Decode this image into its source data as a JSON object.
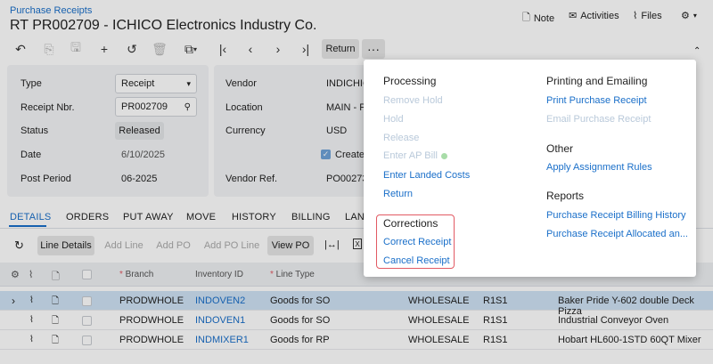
{
  "header": {
    "breadcrumb": "Purchase Receipts",
    "title": "RT PR002709 - ICHICO Electronics Industry Co.",
    "actions": {
      "note": "Note",
      "activities": "Activities",
      "files": "Files"
    }
  },
  "toolbar": {
    "return_label": "Return",
    "more_label": "···"
  },
  "form": {
    "type_label": "Type",
    "type_value": "Receipt",
    "receipt_nbr_label": "Receipt Nbr.",
    "receipt_nbr_value": "PR002709",
    "status_label": "Status",
    "status_value": "Released",
    "date_label": "Date",
    "date_value": "6/10/2025",
    "post_period_label": "Post Period",
    "post_period_value": "06-2025",
    "vendor_label": "Vendor",
    "vendor_value": "INDICHIC",
    "location_label": "Location",
    "location_value": "MAIN - P",
    "currency_label": "Currency",
    "currency_value": "USD",
    "create_label": "Create",
    "vendor_ref_label": "Vendor Ref.",
    "vendor_ref_value": "PO00273"
  },
  "tabs": [
    "DETAILS",
    "ORDERS",
    "PUT AWAY",
    "MOVE",
    "HISTORY",
    "BILLING",
    "LAN"
  ],
  "grid_toolbar": {
    "line_details": "Line Details",
    "add_line": "Add Line",
    "add_po": "Add PO",
    "add_po_line": "Add PO Line",
    "view_po": "View PO"
  },
  "grid": {
    "headers": {
      "branch": "Branch",
      "inventory_id": "Inventory ID",
      "line_type": "Line Type"
    },
    "rows": [
      {
        "branch": "PRODWHOLE",
        "inventory_id": "INDOVEN2",
        "line_type": "Goods for SO",
        "warehouse": "WHOLESALE",
        "location": "R1S1",
        "description": "Baker Pride Y-602 double Deck Pizza"
      },
      {
        "branch": "PRODWHOLE",
        "inventory_id": "INDOVEN1",
        "line_type": "Goods for SO",
        "warehouse": "WHOLESALE",
        "location": "R1S1",
        "description": "Industrial Conveyor Oven"
      },
      {
        "branch": "PRODWHOLE",
        "inventory_id": "INDMIXER1",
        "line_type": "Goods for RP",
        "warehouse": "WHOLESALE",
        "location": "R1S1",
        "description": "Hobart HL600-1STD 60QT Mixer"
      }
    ]
  },
  "menu": {
    "processing": {
      "title": "Processing",
      "items": [
        "Remove Hold",
        "Hold",
        "Release",
        "Enter AP Bill",
        "Enter Landed Costs",
        "Return"
      ]
    },
    "corrections": {
      "title": "Corrections",
      "items": [
        "Correct Receipt",
        "Cancel Receipt"
      ]
    },
    "printing": {
      "title": "Printing and Emailing",
      "items": [
        "Print Purchase Receipt",
        "Email Purchase Receipt"
      ]
    },
    "other": {
      "title": "Other",
      "items": [
        "Apply Assignment Rules"
      ]
    },
    "reports": {
      "title": "Reports",
      "items": [
        "Purchase Receipt Billing History",
        "Purchase Receipt Allocated an..."
      ]
    }
  },
  "colors": {
    "accent": "#1a6fc9",
    "highlight_border": "#e25a63",
    "disabled": "#b9c9da"
  }
}
